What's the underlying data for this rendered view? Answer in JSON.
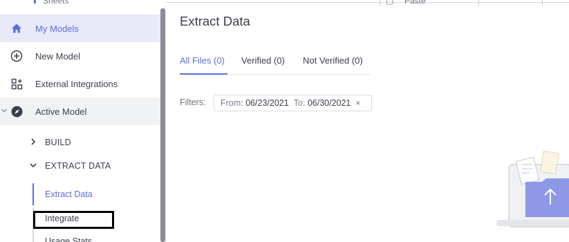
{
  "top_strip": {
    "fragment_left": "Sheets",
    "fragment_right": "Paste"
  },
  "sidebar": {
    "items": [
      {
        "label": "My Models",
        "icon": "home-icon"
      },
      {
        "label": "New Model",
        "icon": "plus-circle-icon"
      },
      {
        "label": "External Integrations",
        "icon": "grid-plus-icon"
      },
      {
        "label": "Active Model",
        "icon": "compass-icon"
      }
    ],
    "groups": [
      {
        "label": "BUILD",
        "icon": "chevron-right-icon"
      },
      {
        "label": "EXTRACT DATA",
        "icon": "chevron-down-icon"
      }
    ],
    "leaves": [
      {
        "label": "Extract Data"
      },
      {
        "label": "Integrate"
      },
      {
        "label": "Usage Stats"
      }
    ]
  },
  "main": {
    "title": "Extract Data",
    "tabs": [
      {
        "label": "All Files (0)"
      },
      {
        "label": "Verified (0)"
      },
      {
        "label": "Not Verified (0)"
      }
    ],
    "filters": {
      "label": "Filters:",
      "from_label": "From:",
      "from_value": "06/23/2021",
      "to_label": "To:",
      "to_value": "06/30/2021",
      "remove": "×"
    }
  },
  "colors": {
    "accent": "#5b6ee1",
    "active_bg": "#e8eaf7",
    "text": "#3b3f4a"
  }
}
